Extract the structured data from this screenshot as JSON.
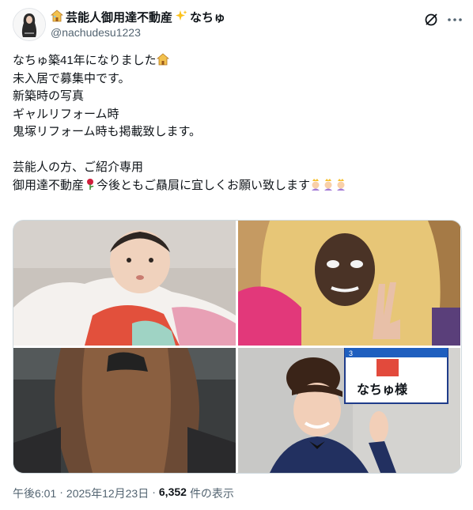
{
  "author": {
    "display_name": "芸能人御用達不動産",
    "name_suffix": "なちゅ",
    "handle": "@nachudesu1223",
    "badge_icon": "house-icon",
    "sparkle_icon": "sparkles-icon"
  },
  "tweet": {
    "lines_a": [
      "なちゅ築41年になりました",
      "未入居で募集中です。",
      "新築時の写真",
      "ギャルリフォーム時",
      "鬼塚リフォーム時も掲載致します。"
    ],
    "lines_b": [
      "芸能人の方、ご紹介専用",
      "御用達不動産",
      "今後ともご贔屓に宜しくお願い致します"
    ]
  },
  "photo_sign": {
    "name_plate": "なちゅ様",
    "plate_number": "3"
  },
  "meta": {
    "time": "午後6:01",
    "date": "2025年12月23日",
    "views_count": "6,352",
    "views_label": "件の表示",
    "separator": "·"
  },
  "colors": {
    "text": "#0f1419",
    "secondary": "#536471",
    "border": "#cfd9de"
  }
}
